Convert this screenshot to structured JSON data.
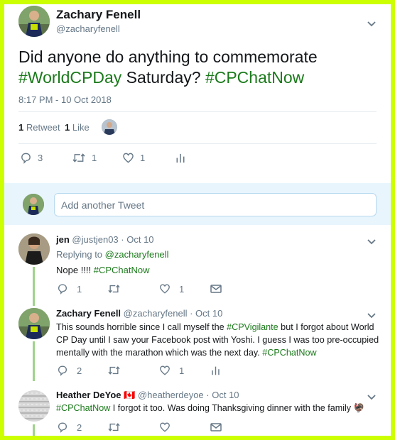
{
  "main_tweet": {
    "display_name": "Zachary Fenell",
    "handle": "@zacharyfenell",
    "text_parts": [
      {
        "text": "Did anyone do anything to commemorate ",
        "type": "text"
      },
      {
        "text": "#WorldCPDay",
        "type": "hashtag"
      },
      {
        "text": " Saturday? ",
        "type": "text"
      },
      {
        "text": "#CPChatNow",
        "type": "hashtag"
      }
    ],
    "timestamp": "8:17 PM - 10 Oct 2018",
    "retweets_count": "1",
    "retweets_label": "Retweet",
    "likes_count": "1",
    "likes_label": "Like",
    "actions": {
      "reply": "3",
      "retweet": "1",
      "like": "1"
    }
  },
  "compose": {
    "placeholder": "Add another Tweet"
  },
  "replies": [
    {
      "display_name": "jen",
      "handle": "@justjen03",
      "time": "· Oct 10",
      "replying_to_label": "Replying to",
      "replying_to_handle": "@zacharyfenell",
      "text_plain": "Nope !!!! ",
      "text_tag": "#CPChatNow",
      "actions": {
        "reply": "1",
        "like": "1"
      }
    },
    {
      "display_name": "Zachary Fenell",
      "handle": "@zacharyfenell",
      "time": "· Oct 10",
      "line1_plain": "This sounds horrible since I call myself the ",
      "line1_tag": "#CPVigilante",
      "line1_rest": " but I forgot about World",
      "line2": "CP Day until I saw your Facebook post with Yoshi. I guess I was too pre-occupied",
      "line3_plain": "mentally with the marathon which was the next day. ",
      "line3_tag": "#CPChatNow",
      "actions": {
        "reply": "2",
        "like": "1"
      }
    },
    {
      "display_name": "Heather DeYoe",
      "flag": "🇨🇦",
      "handle": "@heatherdeyoe",
      "time": "· Oct 10",
      "text_tag": "#CPChatNow",
      "text_plain": " I forgot it too. Was doing Thanksgiving dinner with the family ",
      "emoji": "🦃",
      "actions": {
        "reply": "2"
      }
    }
  ],
  "colors": {
    "border": "#ccff00",
    "hashtag": "#1b7a1b",
    "thread": "#9fd38a"
  }
}
